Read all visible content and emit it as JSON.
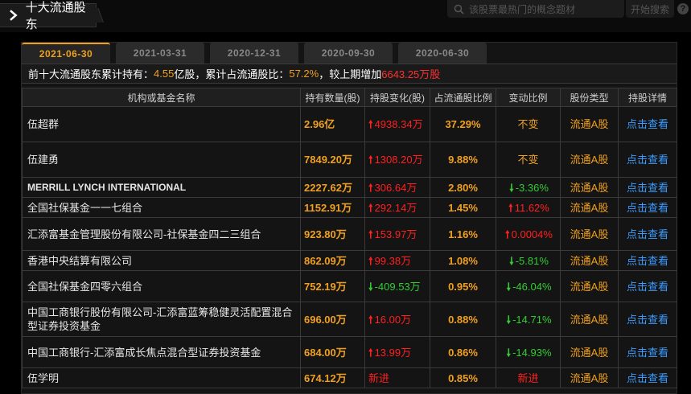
{
  "header": {
    "title": "十大流通股东",
    "search_placeholder": "该股票最热门的概念题材",
    "search_button": "开始搜索",
    "help_glyph": "?"
  },
  "tabs": [
    "2021-06-30",
    "2021-03-31",
    "2020-12-31",
    "2020-09-30",
    "2020-06-30"
  ],
  "active_tab": 0,
  "summary": {
    "label1": "前十大流通股东累计持有：",
    "held": "4.55",
    "held_unit": "亿股，累计占流通股比：",
    "ratio": "57.2%",
    "label2": "，较上期增加",
    "increase": "6643.25万股"
  },
  "columns": [
    "机构或基金名称",
    "持有数量(股)",
    "持股变化(股)",
    "占流通股比例",
    "变动比例",
    "股份类型",
    "持股详情"
  ],
  "rows": [
    {
      "name": "伍超群",
      "qty": "2.96亿",
      "change": "4938.34万",
      "dir": "up",
      "ratio": "37.29%",
      "var": "不变",
      "var_dir": "flat",
      "type": "流通A股",
      "link": "点击查看"
    },
    {
      "name": "伍建勇",
      "qty": "7849.20万",
      "change": "1308.20万",
      "dir": "up",
      "ratio": "9.88%",
      "var": "不变",
      "var_dir": "flat",
      "type": "流通A股",
      "link": "点击查看"
    },
    {
      "name": "MERRILL LYNCH INTERNATIONAL",
      "qty": "2227.62万",
      "change": "306.64万",
      "dir": "up",
      "ratio": "2.80%",
      "var": "-3.36%",
      "var_dir": "down",
      "type": "流通A股",
      "link": "点击查看"
    },
    {
      "name": "全国社保基金一一七组合",
      "qty": "1152.91万",
      "change": "292.14万",
      "dir": "up",
      "ratio": "1.45%",
      "var": "11.62%",
      "var_dir": "up",
      "type": "流通A股",
      "link": "点击查看"
    },
    {
      "name": "汇添富基金管理股份有限公司-社保基金四二三组合",
      "qty": "923.80万",
      "change": "153.97万",
      "dir": "up",
      "ratio": "1.16%",
      "var": "0.0004%",
      "var_dir": "up",
      "type": "流通A股",
      "link": "点击查看"
    },
    {
      "name": "香港中央结算有限公司",
      "qty": "862.09万",
      "change": "99.38万",
      "dir": "up",
      "ratio": "1.08%",
      "var": "-5.81%",
      "var_dir": "down",
      "type": "流通A股",
      "link": "点击查看"
    },
    {
      "name": "全国社保基金四零六组合",
      "qty": "752.19万",
      "change": "-409.53万",
      "dir": "down",
      "ratio": "0.95%",
      "var": "-46.04%",
      "var_dir": "down",
      "type": "流通A股",
      "link": "点击查看"
    },
    {
      "name": "中国工商银行股份有限公司-汇添富蓝筹稳健灵活配置混合型证券投资基金",
      "qty": "696.00万",
      "change": "16.00万",
      "dir": "up",
      "ratio": "0.88%",
      "var": "-14.71%",
      "var_dir": "down",
      "type": "流通A股",
      "link": "点击查看"
    },
    {
      "name": "中国工商银行-汇添富成长焦点混合型证券投资基金",
      "qty": "684.00万",
      "change": "13.99万",
      "dir": "up",
      "ratio": "0.86%",
      "var": "-14.93%",
      "var_dir": "down",
      "type": "流通A股",
      "link": "点击查看"
    },
    {
      "name": "伍学明",
      "qty": "674.12万",
      "change": "新进",
      "dir": "new",
      "ratio": "0.85%",
      "var": "新进",
      "var_dir": "new",
      "type": "流通A股",
      "link": "点击查看"
    }
  ],
  "colors": {
    "accent": "#f0a020",
    "up": "#ff2020",
    "down": "#33cc33",
    "link": "#3c9cff"
  }
}
